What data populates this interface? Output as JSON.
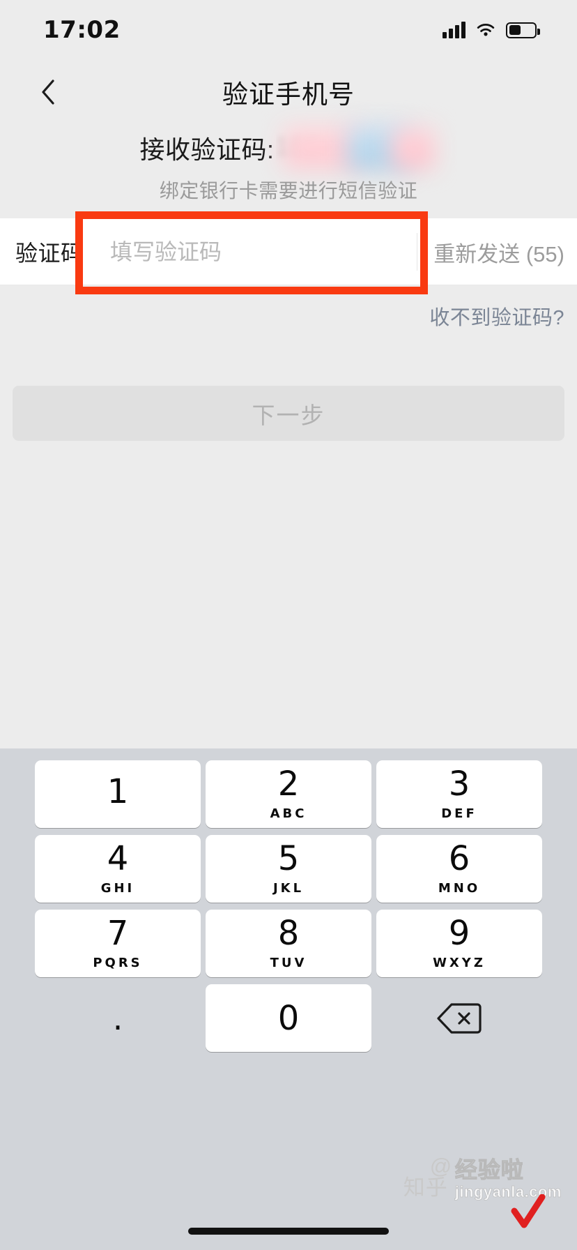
{
  "status_bar": {
    "time": "17:02",
    "signal_icon": "cellular-bars-icon",
    "wifi_icon": "wifi-icon",
    "battery_icon": "battery-icon"
  },
  "nav": {
    "back_icon": "chevron-left-icon",
    "title": "验证手机号"
  },
  "header": {
    "receive_label": "接收验证码:",
    "phone_masked": "186••••",
    "subtitle": "绑定银行卡需要进行短信验证"
  },
  "form": {
    "code_label": "验证码",
    "code_value": "",
    "code_placeholder": "填写验证码",
    "resend_label": "重新发送 (55)",
    "resend_seconds": 55,
    "help_link": "收不到验证码?"
  },
  "actions": {
    "next_label": "下一步"
  },
  "keyboard": {
    "keys": [
      {
        "num": "1",
        "sub": ""
      },
      {
        "num": "2",
        "sub": "ABC"
      },
      {
        "num": "3",
        "sub": "DEF"
      },
      {
        "num": "4",
        "sub": "GHI"
      },
      {
        "num": "5",
        "sub": "JKL"
      },
      {
        "num": "6",
        "sub": "MNO"
      },
      {
        "num": "7",
        "sub": "PQRS"
      },
      {
        "num": "8",
        "sub": "TUV"
      },
      {
        "num": "9",
        "sub": "WXYZ"
      },
      {
        "num": ".",
        "sub": ""
      },
      {
        "num": "0",
        "sub": ""
      },
      {
        "num": "",
        "sub": "",
        "icon": "backspace-icon"
      }
    ]
  },
  "watermark": {
    "platform": "知乎",
    "at": "@",
    "author": "经验啦",
    "url": "jingyanla.com",
    "check_icon": "red-check-icon"
  },
  "colors": {
    "annotation_red": "#f93a11",
    "page_background": "#ececec",
    "card_background": "#ffffff",
    "keyboard_background": "#d1d4d9",
    "key_background": "#ffffff",
    "disabled_button": "#e0e0e0",
    "link_blue_gray": "#7b8595",
    "placeholder_gray": "#b9b9b9"
  }
}
